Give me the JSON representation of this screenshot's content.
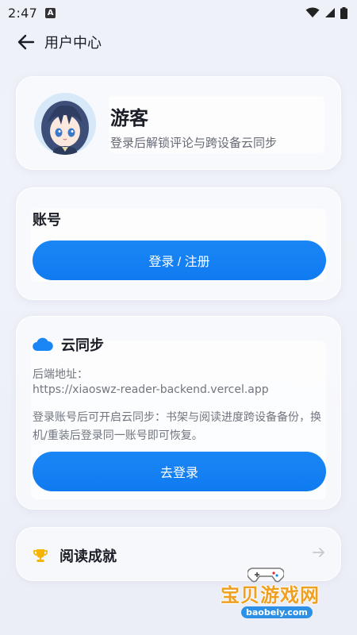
{
  "status": {
    "time": "2:47",
    "notif_letter": "A"
  },
  "header": {
    "title": "用户中心"
  },
  "profile": {
    "name": "游客",
    "subtitle": "登录后解锁评论与跨设备云同步"
  },
  "account": {
    "label": "账号",
    "button": "登录 / 注册"
  },
  "sync": {
    "title": "云同步",
    "backend_label": "后端地址：",
    "backend_url": "https://xiaoswz-reader-backend.vercel.app",
    "description": "登录账号后可开启云同步：书架与阅读进度跨设备备份，换机/重装后登录同一账号即可恢复。",
    "button": "去登录"
  },
  "achievements": {
    "title": "阅读成就"
  },
  "watermark": {
    "text": "宝贝游戏网",
    "url": "baobeiy.com"
  },
  "colors": {
    "primary": "#0f7bf0",
    "trophy": "#f5b400",
    "cloud": "#1a86f5"
  }
}
